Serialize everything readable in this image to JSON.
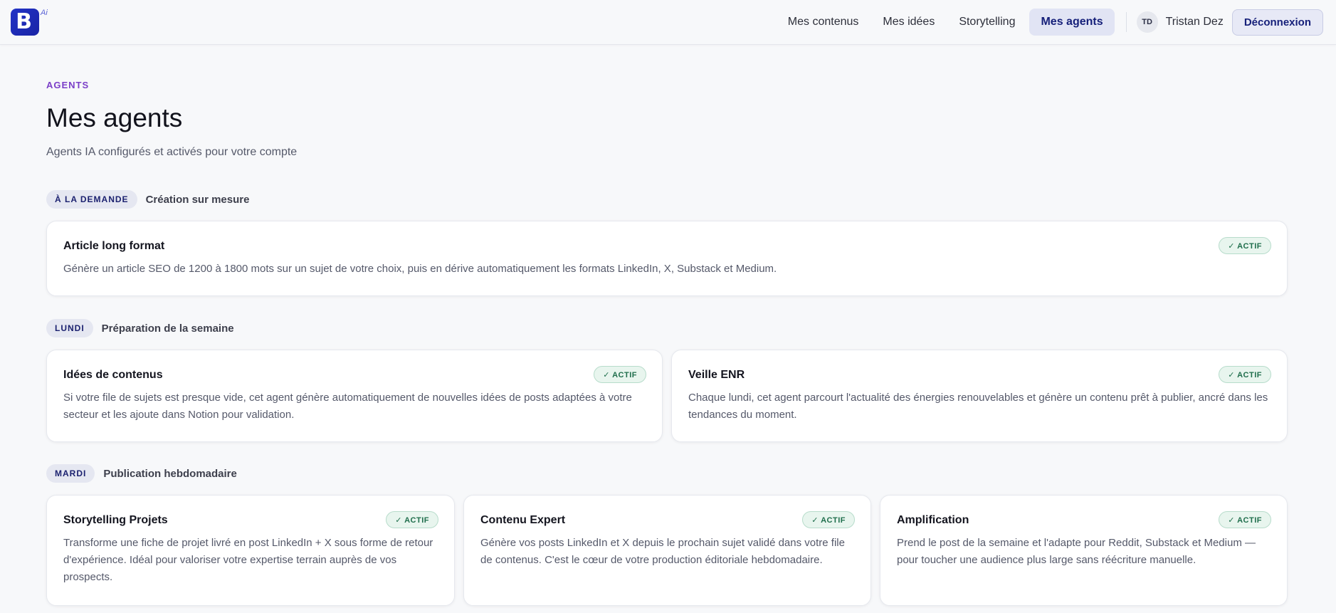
{
  "header": {
    "logo_letter": "B",
    "logo_badge": "Ai",
    "nav": [
      {
        "label": "Mes contenus"
      },
      {
        "label": "Mes idées"
      },
      {
        "label": "Storytelling"
      },
      {
        "label": "Mes agents",
        "active": true
      }
    ],
    "user": {
      "initials": "TD",
      "name": "Tristan Dez"
    },
    "logout_label": "Déconnexion"
  },
  "page": {
    "eyebrow": "AGENTS",
    "title": "Mes agents",
    "subtitle": "Agents IA configurés et activés pour votre compte"
  },
  "sections": [
    {
      "pill": "À LA DEMANDE",
      "desc": "Création sur mesure",
      "cards": [
        {
          "title": "Article long format",
          "badge": "✓ ACTIF",
          "desc": "Génère un article SEO de 1200 à 1800 mots sur un sujet de votre choix, puis en dérive automatiquement les formats LinkedIn, X, Substack et Medium."
        }
      ]
    },
    {
      "pill": "LUNDI",
      "desc": "Préparation de la semaine",
      "cards": [
        {
          "title": "Idées de contenus",
          "badge": "✓ ACTIF",
          "desc": "Si votre file de sujets est presque vide, cet agent génère automatiquement de nouvelles idées de posts adaptées à votre secteur et les ajoute dans Notion pour validation."
        },
        {
          "title": "Veille ENR",
          "badge": "✓ ACTIF",
          "desc": "Chaque lundi, cet agent parcourt l'actualité des énergies renouvelables et génère un contenu prêt à publier, ancré dans les tendances du moment."
        }
      ]
    },
    {
      "pill": "MARDI",
      "desc": "Publication hebdomadaire",
      "cards": [
        {
          "title": "Storytelling Projets",
          "badge": "✓ ACTIF",
          "desc": "Transforme une fiche de projet livré en post LinkedIn + X sous forme de retour d'expérience. Idéal pour valoriser votre expertise terrain auprès de vos prospects."
        },
        {
          "title": "Contenu Expert",
          "badge": "✓ ACTIF",
          "desc": "Génère vos posts LinkedIn et X depuis le prochain sujet validé dans votre file de contenus. C'est le cœur de votre production éditoriale hebdomadaire."
        },
        {
          "title": "Amplification",
          "badge": "✓ ACTIF",
          "desc": "Prend le post de la semaine et l'adapte pour Reddit, Substack et Medium — pour toucher une audience plus large sans réécriture manuelle."
        }
      ]
    }
  ],
  "colors": {
    "brand": "#2233c6",
    "accent_eyebrow": "#7b3fc8",
    "active_badge": "#1f6e4c",
    "nav_active_bg": "#e1e4f4"
  }
}
